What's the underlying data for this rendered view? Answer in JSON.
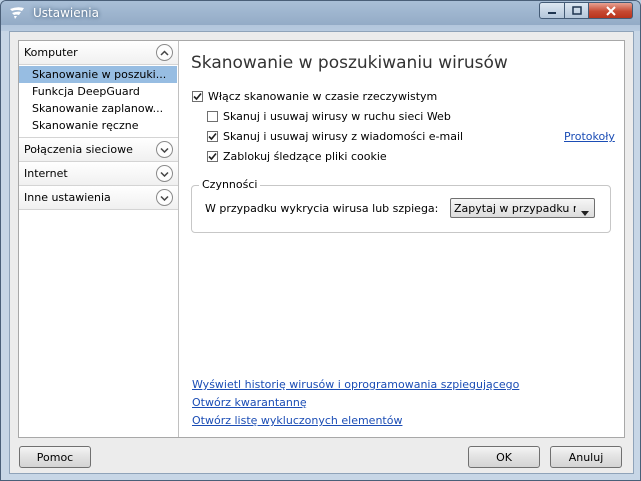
{
  "window": {
    "title": "Ustawienia",
    "icon": "f-secure-logo-icon"
  },
  "sidebar": {
    "sections": [
      {
        "label": "Komputer",
        "expanded": true,
        "items": [
          {
            "label": "Skanowanie w poszuki...",
            "selected": true
          },
          {
            "label": "Funkcja DeepGuard"
          },
          {
            "label": "Skanowanie zaplanow..."
          },
          {
            "label": "Skanowanie ręczne"
          }
        ]
      },
      {
        "label": "Połączenia sieciowe",
        "expanded": false
      },
      {
        "label": "Internet",
        "expanded": false
      },
      {
        "label": "Inne ustawienia",
        "expanded": false
      }
    ]
  },
  "main": {
    "title": "Skanowanie w poszukiwaniu wirusów",
    "realtime": {
      "label": "Włącz skanowanie w czasie rzeczywistym",
      "checked": true
    },
    "options": [
      {
        "label": "Skanuj i usuwaj wirusy w ruchu sieci Web",
        "checked": false
      },
      {
        "label": "Skanuj i usuwaj wirusy z wiadomości e-mail",
        "checked": true
      },
      {
        "label": "Zablokuj śledzące pliki cookie",
        "checked": true
      }
    ],
    "protocols_link": "Protokoły",
    "actions": {
      "legend": "Czynności",
      "label": "W przypadku wykrycia wirusa lub szpiega:",
      "selected": "Zapytaj w przypadku niejednoznaczności"
    },
    "links": [
      "Wyświetl historię wirusów i oprogramowania szpiegującego",
      "Otwórz kwarantannę",
      "Otwórz listę wykluczonych elementów"
    ]
  },
  "footer": {
    "help": "Pomoc",
    "ok": "OK",
    "cancel": "Anuluj"
  },
  "colors": {
    "selection": "#97bde2",
    "link": "#1b4db5",
    "close_button": "#c74a33"
  }
}
